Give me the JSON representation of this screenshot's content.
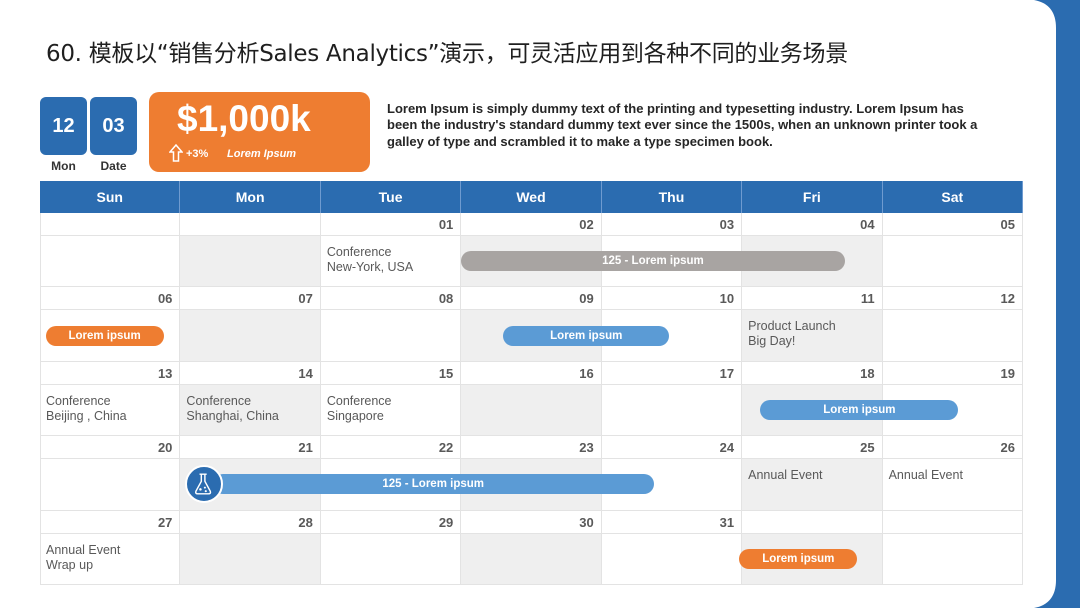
{
  "title": "60. 模板以“销售分析Sales Analytics”演示，可灵活应用到各种不同的业务场景",
  "date": {
    "month": "12",
    "day": "03",
    "month_label": "Mon",
    "day_label": "Date"
  },
  "kpi": {
    "value": "$1,000k",
    "change": "+3%",
    "label": "Lorem Ipsum",
    "color": "#ee7d31"
  },
  "description": "Lorem Ipsum is simply dummy text of the printing and typesetting industry. Lorem Ipsum has been the industry's standard dummy text ever since the 1500s, when an unknown printer took a galley of type and scrambled it to make a type specimen book.",
  "calendar": {
    "weekdays": [
      "Sun",
      "Mon",
      "Tue",
      "Wed",
      "Thu",
      "Fri",
      "Sat"
    ],
    "weeks": [
      [
        "",
        "",
        "01",
        "02",
        "03",
        "04",
        "05"
      ],
      [
        "06",
        "07",
        "08",
        "09",
        "10",
        "11",
        "12"
      ],
      [
        "13",
        "14",
        "15",
        "16",
        "17",
        "18",
        "19"
      ],
      [
        "20",
        "21",
        "22",
        "23",
        "24",
        "25",
        "26"
      ],
      [
        "27",
        "28",
        "29",
        "30",
        "31",
        "",
        ""
      ]
    ],
    "shaded_columns": [
      1,
      3,
      5
    ],
    "notes": [
      {
        "week": 0,
        "day": 2,
        "lines": [
          "Conference",
          "New-York, USA"
        ]
      },
      {
        "week": 1,
        "day": 5,
        "lines": [
          "Product Launch",
          "Big Day!"
        ]
      },
      {
        "week": 2,
        "day": 0,
        "lines": [
          "Conference",
          "Beijing , China"
        ]
      },
      {
        "week": 2,
        "day": 1,
        "lines": [
          "Conference",
          "Shanghai, China"
        ]
      },
      {
        "week": 2,
        "day": 2,
        "lines": [
          "Conference",
          "Singapore"
        ]
      },
      {
        "week": 3,
        "day": 5,
        "lines": [
          "Annual Event"
        ]
      },
      {
        "week": 3,
        "day": 6,
        "lines": [
          "Annual Event"
        ]
      },
      {
        "week": 4,
        "day": 0,
        "lines": [
          "Annual Event",
          "Wrap up"
        ]
      }
    ],
    "events": [
      {
        "label": "125 - Lorem ipsum",
        "color": "gray",
        "week": 0,
        "start": 3.0,
        "end": 5.73
      },
      {
        "label": "Lorem ipsum",
        "color": "orange",
        "week": 1,
        "start": 0.04,
        "end": 0.88
      },
      {
        "label": "Lorem ipsum",
        "color": "blue",
        "week": 1,
        "start": 3.3,
        "end": 4.48
      },
      {
        "label": "Lorem ipsum",
        "color": "blue",
        "week": 2,
        "start": 5.13,
        "end": 6.54
      },
      {
        "label": "125 - Lorem ipsum",
        "color": "blue",
        "week": 3,
        "start": 1.23,
        "end": 4.37,
        "icon": "flask-icon"
      },
      {
        "label": "Lorem ipsum",
        "color": "orange",
        "week": 4,
        "start": 4.98,
        "end": 5.82
      }
    ]
  },
  "colors": {
    "primary": "#2b6cb0",
    "accent": "#ee7d31",
    "bar_blue": "#5b9bd5",
    "bar_gray": "#a8a4a2",
    "shade": "#efefef"
  }
}
